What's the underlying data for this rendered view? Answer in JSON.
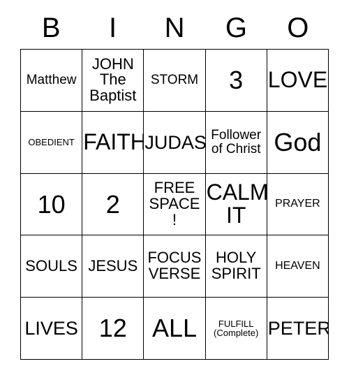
{
  "header": {
    "letters": [
      "B",
      "I",
      "N",
      "G",
      "O"
    ]
  },
  "grid": {
    "rows": 5,
    "columns": 5,
    "border_color": "#000000",
    "background_color": "#ffffff",
    "text_color": "#000000",
    "cells": [
      {
        "text": "Matthew",
        "size": "md"
      },
      {
        "text": "JOHN\nThe\nBaptist",
        "size": "lg"
      },
      {
        "text": "STORM",
        "size": "md"
      },
      {
        "text": "3",
        "size": "huge"
      },
      {
        "text": "LOVE",
        "size": "xxl"
      },
      {
        "text": "OBEDIENT",
        "size": "xs"
      },
      {
        "text": "FAITH",
        "size": "xxl"
      },
      {
        "text": "JUDAS",
        "size": "xl"
      },
      {
        "text": "Follower\nof Christ",
        "size": "md"
      },
      {
        "text": "God",
        "size": "huge"
      },
      {
        "text": "10",
        "size": "huge"
      },
      {
        "text": "2",
        "size": "huge"
      },
      {
        "text": "FREE\nSPACE\n!",
        "size": "lg"
      },
      {
        "text": "CALM\nIT",
        "size": "xxl"
      },
      {
        "text": "PRAYER",
        "size": "sm"
      },
      {
        "text": "SOULS",
        "size": "lg"
      },
      {
        "text": "JESUS",
        "size": "lg"
      },
      {
        "text": "FOCUS\nVERSE",
        "size": "lg"
      },
      {
        "text": "HOLY\nSPIRIT",
        "size": "lg"
      },
      {
        "text": "HEAVEN",
        "size": "sm"
      },
      {
        "text": "LIVES",
        "size": "xl"
      },
      {
        "text": "12",
        "size": "huge"
      },
      {
        "text": "ALL",
        "size": "huge"
      },
      {
        "text": "FULFILL\n(Complete)",
        "size": "xs"
      },
      {
        "text": "PETER",
        "size": "xl"
      }
    ]
  }
}
